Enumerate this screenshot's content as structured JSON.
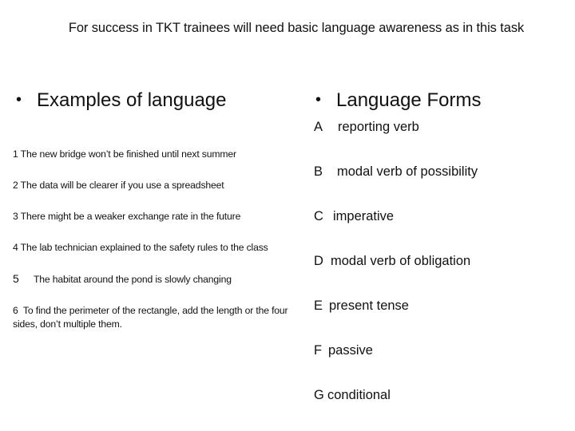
{
  "title": "For success in TKT trainees will need basic language awareness as in this task",
  "left_column": {
    "heading": "Examples of language",
    "examples": [
      {
        "number": "1",
        "text": "The new bridge won’t be finished until next summer"
      },
      {
        "number": "2",
        "text": "The data will be clearer if you use a spreadsheet"
      },
      {
        "number": "3",
        "text": "There might be a weaker exchange rate in the future"
      },
      {
        "number": "4",
        "text": "The lab technician explained to the safety  rules to the class"
      },
      {
        "number": "5",
        "text": "The habitat around the pond is slowly changing"
      },
      {
        "number": "6",
        "text": "To find the perimeter of the rectangle, add the length or the four sides, don’t multiple them."
      }
    ]
  },
  "right_column": {
    "heading": "Language Forms",
    "forms": [
      {
        "letter": "A",
        "text": "reporting verb"
      },
      {
        "letter": "B",
        "text": "modal verb of possibility"
      },
      {
        "letter": "C",
        "text": "imperative"
      },
      {
        "letter": "D",
        "text": "modal verb of obligation"
      },
      {
        "letter": "E",
        "text": "present tense"
      },
      {
        "letter": "F",
        "text": "passive"
      },
      {
        "letter": "G",
        "text": "conditional"
      }
    ]
  },
  "bullet_symbol": "•"
}
